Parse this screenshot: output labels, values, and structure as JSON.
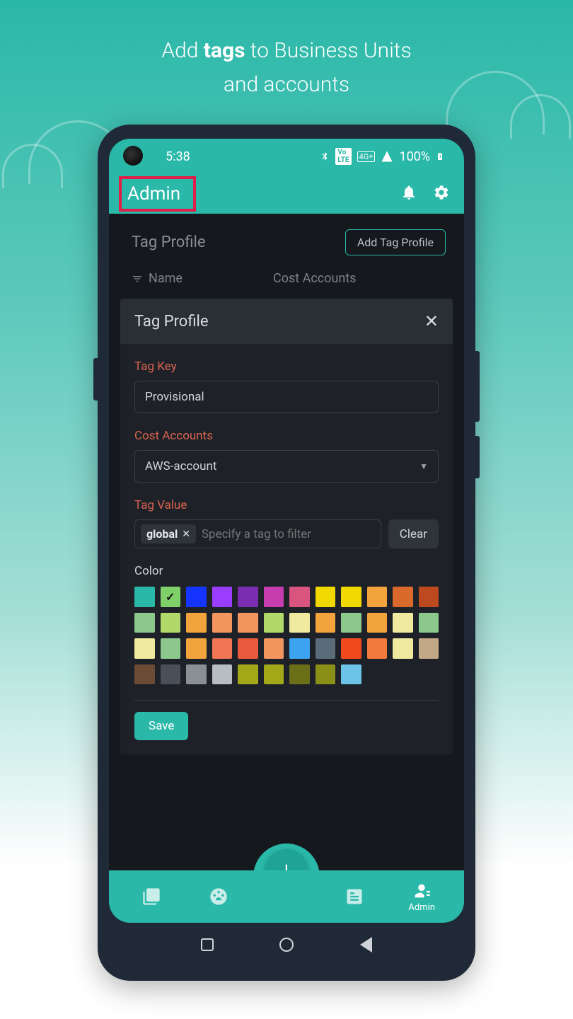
{
  "tagline": {
    "pre": "Add ",
    "bold": "tags",
    "mid": " to Business Units",
    "line2": "and accounts"
  },
  "statusBar": {
    "time": "5:38",
    "network": "4G+",
    "lte": "VoLTE",
    "battery": "100%"
  },
  "header": {
    "title": "Admin"
  },
  "tagProfile": {
    "title": "Tag Profile",
    "addBtn": "Add Tag Profile",
    "nameCol": "Name",
    "costCol": "Cost Accounts"
  },
  "modal": {
    "title": "Tag Profile",
    "tagKeyLabel": "Tag Key",
    "tagKeyValue": "Provisional",
    "costAccountsLabel": "Cost Accounts",
    "costAccountsValue": "AWS-account",
    "tagValueLabel": "Tag Value",
    "tagValueChip": "global",
    "tagValuePlaceholder": "Specify a tag to filter",
    "clearBtn": "Clear",
    "colorLabel": "Color",
    "saveBtn": "Save",
    "colors": [
      "#2ab8a8",
      "#7fd069",
      "#1535ff",
      "#9b3dff",
      "#7a2db0",
      "#c73db0",
      "#d95580",
      "#f0d800",
      "#f0d800",
      "#f2a33c",
      "#d96a2c",
      "#bd4a1f",
      "#8cc78c",
      "#b0d96a",
      "#f2a33c",
      "#f2955f",
      "#f2955f",
      "#b0d96a",
      "#f0ea9e",
      "#f2a33c",
      "#8cc78c",
      "#f2a33c",
      "#f0ea9e",
      "#8cc78c",
      "#f0ea9e",
      "#8cc78c",
      "#f2a33c",
      "#f07555",
      "#e85a3c",
      "#f2955f",
      "#3da3f0",
      "#5a6b7a",
      "#f24a1f",
      "#f27a3c",
      "#f0ea9e",
      "#c2a886",
      "#6b4a36",
      "#4a4f58",
      "#8a8f95",
      "#b8bdc2",
      "#a3a818",
      "#a3a818",
      "#6b6f18",
      "#8a8f18",
      "#6bc3e8"
    ],
    "selectedColorIndex": 1
  },
  "bottomNav": {
    "adminLabel": "Admin"
  },
  "fab": {
    "label": "+"
  }
}
